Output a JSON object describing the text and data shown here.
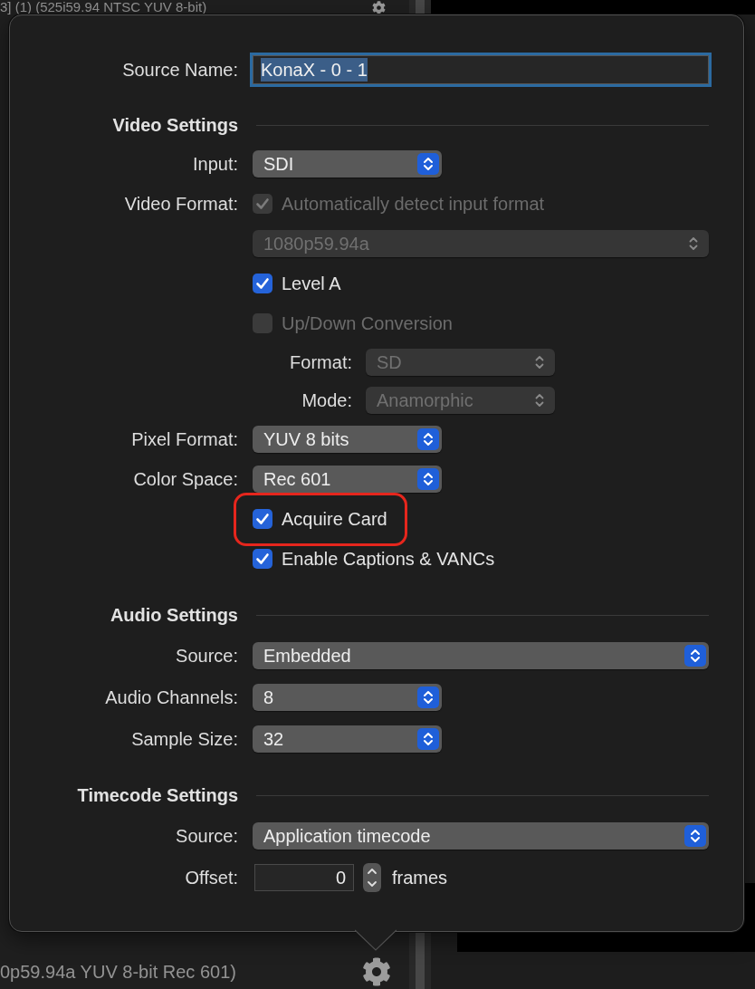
{
  "background": {
    "top_text": "3] (1) (525i59.94 NTSC YUV 8-bit)",
    "bottom_text": "0p59.94a YUV 8-bit Rec 601)"
  },
  "popover": {
    "source_name": {
      "label": "Source Name:",
      "value": "KonaX - 0 - 1",
      "focused": true,
      "text_selected": true
    },
    "sections": [
      {
        "title": "Video Settings",
        "rows": [
          {
            "kind": "popup",
            "label": "Input:",
            "value": "SDI",
            "disabled": false
          },
          {
            "kind": "checkbox",
            "label": "Video Format:",
            "text": "Automatically detect input format",
            "checked": true,
            "disabled": true,
            "highlighted": false
          },
          {
            "kind": "popup_wide",
            "value": "1080p59.94a",
            "disabled": true
          },
          {
            "kind": "checkbox",
            "text": "Level A",
            "checked": true,
            "disabled": false,
            "highlighted": false
          },
          {
            "kind": "checkbox",
            "text": "Up/Down Conversion",
            "checked": false,
            "disabled": true,
            "highlighted": false
          },
          {
            "kind": "sub_popup",
            "label": "Format:",
            "value": "SD",
            "disabled": true
          },
          {
            "kind": "sub_popup",
            "label": "Mode:",
            "value": "Anamorphic",
            "disabled": true
          },
          {
            "kind": "popup",
            "label": "Pixel Format:",
            "value": "YUV 8 bits",
            "disabled": false
          },
          {
            "kind": "popup",
            "label": "Color Space:",
            "value": "Rec 601",
            "disabled": false
          },
          {
            "kind": "checkbox",
            "text": "Acquire Card",
            "checked": true,
            "disabled": false,
            "highlighted": true
          },
          {
            "kind": "checkbox",
            "text": "Enable Captions & VANCs",
            "checked": true,
            "disabled": false,
            "highlighted": false
          }
        ]
      },
      {
        "title": "Audio Settings",
        "rows": [
          {
            "kind": "popup_wide",
            "label": "Source:",
            "value": "Embedded",
            "disabled": false
          },
          {
            "kind": "popup",
            "label": "Audio Channels:",
            "value": "8",
            "disabled": false
          },
          {
            "kind": "popup",
            "label": "Sample Size:",
            "value": "32",
            "disabled": false
          }
        ]
      },
      {
        "title": "Timecode Settings",
        "rows": [
          {
            "kind": "popup_wide",
            "label": "Source:",
            "value": "Application timecode",
            "disabled": false
          },
          {
            "kind": "stepper",
            "label": "Offset:",
            "value": "0",
            "unit": "frames"
          }
        ]
      }
    ]
  }
}
